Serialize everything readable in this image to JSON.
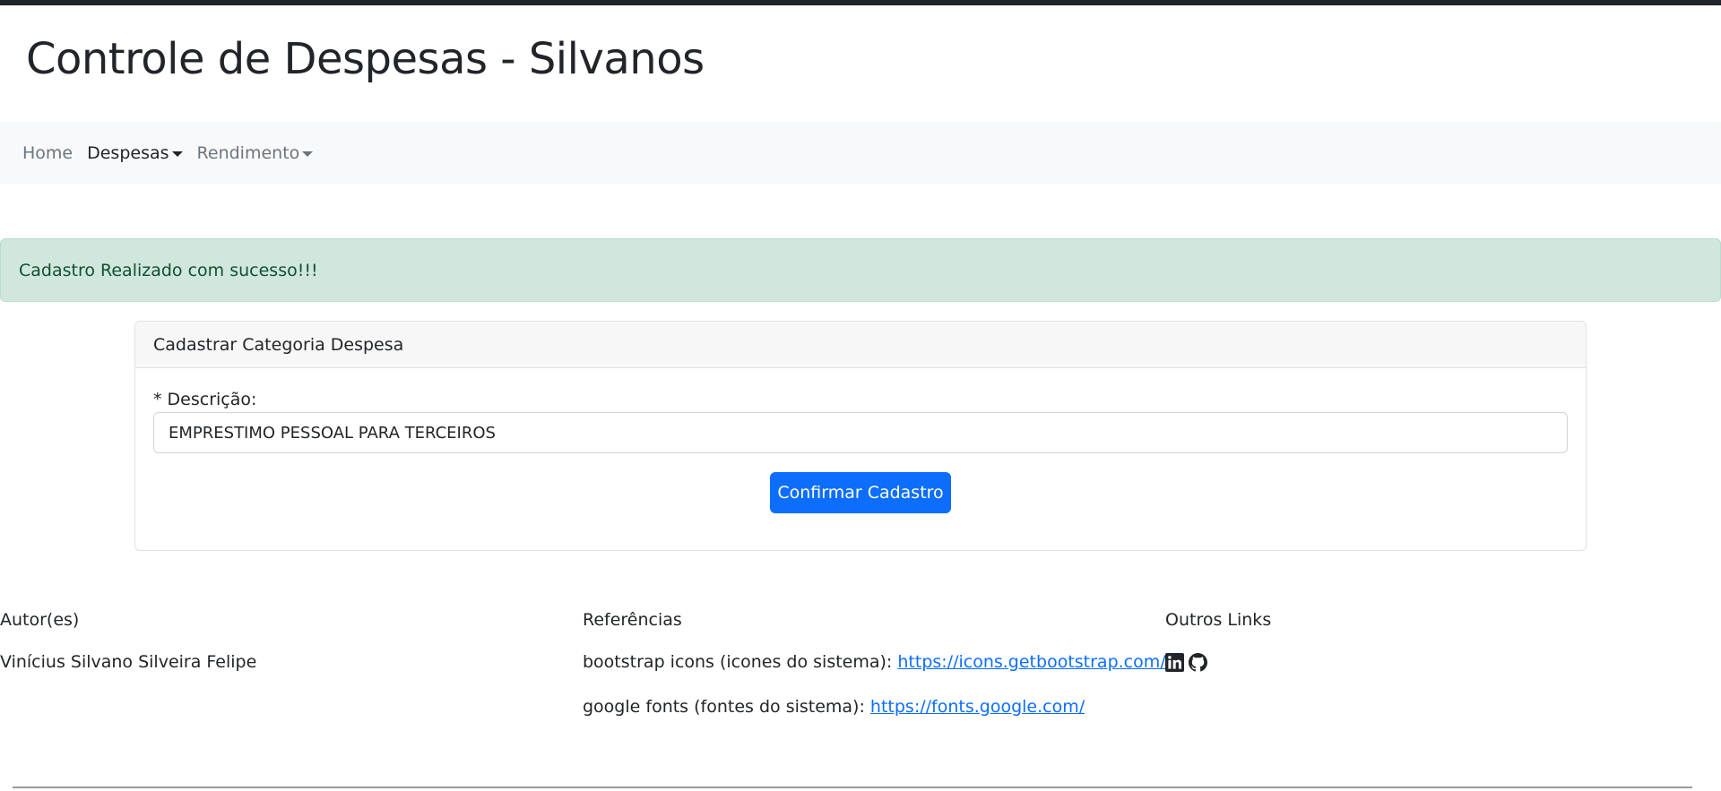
{
  "header": {
    "title": "Controle de Despesas - Silvanos"
  },
  "nav": {
    "items": [
      {
        "label": "Home",
        "dropdown": false,
        "active": false
      },
      {
        "label": "Despesas",
        "dropdown": true,
        "active": true
      },
      {
        "label": "Rendimento",
        "dropdown": true,
        "active": false
      }
    ]
  },
  "alert": {
    "message": "Cadastro Realizado com sucesso!!!"
  },
  "form": {
    "card_title": "Cadastrar Categoria Despesa",
    "description_label": "* Descrição:",
    "description_value": "EMPRESTIMO PESSOAL PARA TERCEIROS",
    "submit_label": "Confirmar Cadastro"
  },
  "footer": {
    "authors": {
      "heading": "Autor(es)",
      "name": "Vinícius Silvano Silveira Felipe"
    },
    "references": {
      "heading": "Referências",
      "items": [
        {
          "prefix": "bootstrap icons (icones do sistema): ",
          "link": "https://icons.getbootstrap.com/"
        },
        {
          "prefix": "google fonts (fontes do sistema): ",
          "link": "https://fonts.google.com/"
        }
      ]
    },
    "links": {
      "heading": "Outros Links",
      "icons": [
        "linkedin-icon",
        "github-icon"
      ]
    }
  },
  "colors": {
    "primary": "#0d6efd",
    "success_bg": "#d1e7dd",
    "success_text": "#0f5132",
    "navbar_bg": "#f8f9fa",
    "topbar": "#212529"
  }
}
